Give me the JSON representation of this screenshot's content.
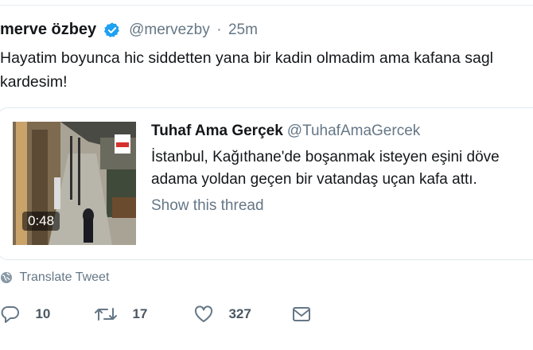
{
  "tweet": {
    "author_name": "merve özbey",
    "author_handle": "@mervezby",
    "separator": "·",
    "time": "25m",
    "text": "Hayatim boyunca hic siddetten yana bir kadin olmadim ama kafana sagl\nkardesim!"
  },
  "quoted_tweet": {
    "author_name": "Tuhaf Ama Gerçek",
    "author_handle": "@TuhafAmaGercek",
    "text": "İstanbul, Kağıthane'de boşanmak isteyen eşini döve\nadama yoldan geçen bir vatandaş uçan kafa attı.",
    "thread_link": "Show this thread",
    "video_duration": "0:48"
  },
  "translate": {
    "label": "Translate Tweet",
    "icon": "globe-icon"
  },
  "actions": {
    "reply_count": "10",
    "retweet_count": "17",
    "like_count": "327",
    "icons": [
      "reply-icon",
      "retweet-icon",
      "like-icon",
      "message-icon"
    ]
  },
  "colors": {
    "verified": "#1da1f2",
    "secondary_text": "#657786",
    "border": "#e1e8ed"
  }
}
